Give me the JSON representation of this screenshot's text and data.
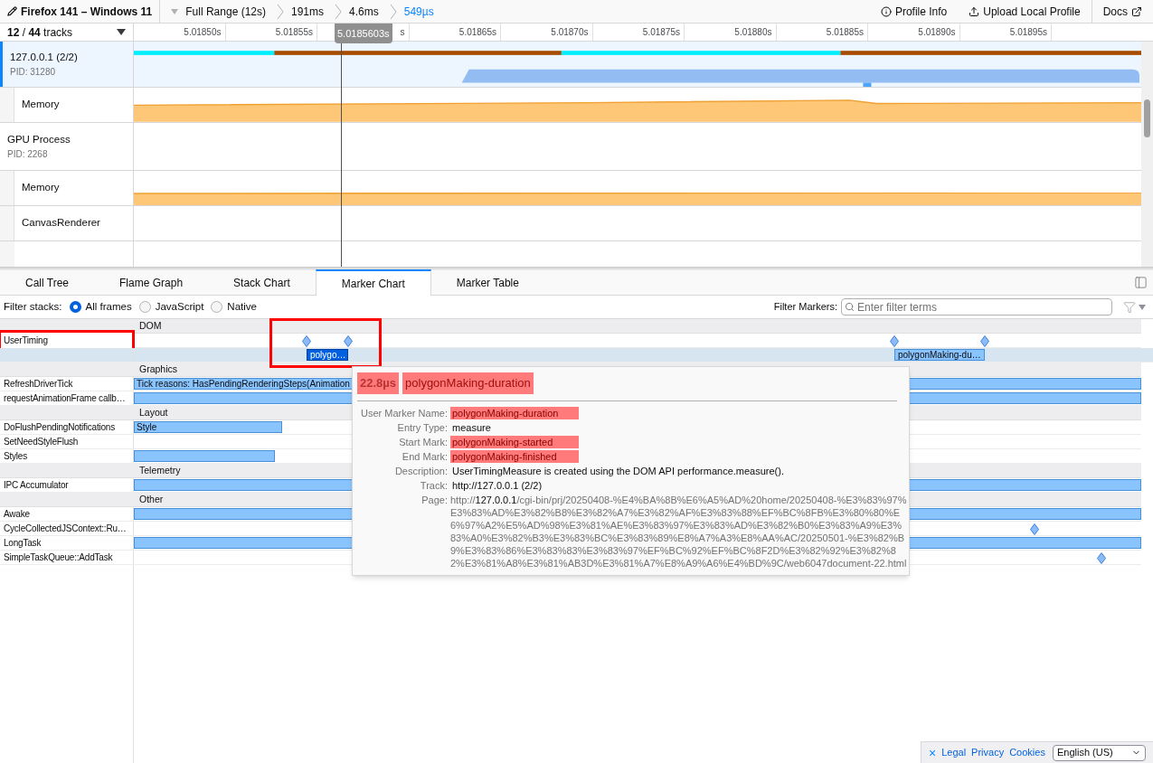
{
  "toolbar": {
    "title": "Firefox 141 – Windows 11",
    "breadcrumbs": [
      {
        "label": "Full Range (12s)",
        "selected": false
      },
      {
        "label": "191ms",
        "selected": false
      },
      {
        "label": "4.6ms",
        "selected": false
      },
      {
        "label": "549µs",
        "selected": true
      }
    ],
    "actions": [
      {
        "kind": "info",
        "label": "Profile Info"
      },
      {
        "kind": "upload",
        "label": "Upload Local Profile"
      },
      {
        "kind": "docs",
        "label": "Docs"
      }
    ]
  },
  "timeline": {
    "track_count": "**12** / **44** tracks",
    "ticks": [
      "5.01850s",
      "5.01855s",
      "s",
      "5.01865s",
      "5.01870s",
      "5.01875s",
      "5.01880s",
      "5.01885s",
      "5.01890s",
      "5.01895s"
    ],
    "hover_time": "5.0185603s",
    "tracks": [
      {
        "kind": "process",
        "name": "127.0.0.1 (2/2)",
        "pid": "PID: 31280",
        "selected": true,
        "children": [
          {
            "kind": "memory",
            "name": "Memory",
            "selected": false
          }
        ]
      },
      {
        "kind": "process",
        "name": "GPU Process",
        "pid": "PID: 2268",
        "selected": false,
        "children": [
          {
            "kind": "memory",
            "name": "Memory",
            "selected": false
          },
          {
            "kind": "canvas",
            "name": "CanvasRenderer",
            "selected": false
          }
        ]
      }
    ]
  },
  "tabs": [
    {
      "label": "Call Tree",
      "selected": false
    },
    {
      "label": "Flame Graph",
      "selected": false
    },
    {
      "label": "Stack Chart",
      "selected": false
    },
    {
      "label": "Marker Chart",
      "selected": true
    },
    {
      "label": "Marker Table",
      "selected": false
    }
  ],
  "filter": {
    "label": "Filter stacks:",
    "options": [
      {
        "label": "All frames",
        "selected": true
      },
      {
        "label": "JavaScript",
        "selected": false
      },
      {
        "label": "Native",
        "selected": false
      }
    ],
    "markers_label": "Filter Markers:",
    "placeholder": "Enter filter terms"
  },
  "marker_rows": [
    {
      "kind": "header",
      "label": "DOM"
    },
    {
      "kind": "row",
      "label": "UserTiming",
      "annotated": true,
      "selected": false
    },
    {
      "kind": "row",
      "selected": true,
      "markers": [
        {
          "label": "polygo…",
          "selected": true,
          "annotated": true
        },
        {
          "label": "polygonMaking-du…",
          "selected": false,
          "annotated": false
        }
      ]
    },
    {
      "kind": "header",
      "label": "Graphics"
    },
    {
      "kind": "row",
      "label": "RefreshDriverTick",
      "annotated": false,
      "selected": false,
      "bar_label": "Tick reasons: HasPendingRenderingSteps(Animation"
    },
    {
      "kind": "row",
      "label": "requestAnimationFrame callb…",
      "annotated": false,
      "selected": false
    },
    {
      "kind": "header",
      "label": "Layout"
    },
    {
      "kind": "row",
      "label": "DoFlushPendingNotifications",
      "annotated": false,
      "selected": false,
      "bar_label": "Style"
    },
    {
      "kind": "row",
      "label": "SetNeedStyleFlush",
      "annotated": false,
      "selected": false
    },
    {
      "kind": "row",
      "label": "Styles",
      "annotated": false,
      "selected": false
    },
    {
      "kind": "header",
      "label": "Telemetry"
    },
    {
      "kind": "row",
      "label": "IPC Accumulator",
      "annotated": false,
      "selected": false
    },
    {
      "kind": "header",
      "label": "Other"
    },
    {
      "kind": "row",
      "label": "Awake",
      "annotated": false,
      "selected": false
    },
    {
      "kind": "row",
      "label": "CycleCollectedJSContext::Ru…",
      "annotated": false,
      "selected": false
    },
    {
      "kind": "row",
      "label": "LongTask",
      "annotated": false,
      "selected": false
    },
    {
      "kind": "row",
      "label": "SimpleTaskQueue::AddTask",
      "annotated": false,
      "selected": false
    }
  ],
  "tooltip": {
    "duration": "22.8µs",
    "title": "polygonMaking-duration",
    "highlighted": true,
    "fields": [
      {
        "label": "User Marker Name:",
        "value": "polygonMaking-duration",
        "highlighted": true
      },
      {
        "label": "Entry Type:",
        "value": "measure",
        "highlighted": false
      },
      {
        "label": "Start Mark:",
        "value": "polygonMaking-started",
        "highlighted": true
      },
      {
        "label": "End Mark:",
        "value": "polygonMaking-finished",
        "highlighted": true
      },
      {
        "label": "Description:",
        "value": "UserTimingMeasure is created using the DOM API performance.measure().",
        "highlighted": false
      },
      {
        "label": "Track:",
        "value": "http://127.0.0.1 (2/2)",
        "highlighted": false
      },
      {
        "label": "Page:",
        "kind": "url",
        "value_parts": [
          "http://",
          "127.0.0.1",
          "/cgi-bin/prj/20250408-%E4%BA%8B%E6%A5%AD%20home/20250408-%E3%83%97%E3%83%AD%E3%82%B8%E3%82%A7%E3%82%AF%E3%83%88%EF%BC%8FB%E3%80%80%E6%97%A2%E5%AD%98%E3%81%AE%E3%83%97%E3%83%AD%E3%82%B0%E3%83%A9%E3%83%A0%E3%82%B3%E3%83%BC%E3%83%89%E8%A7%A3%E8%AA%AC/20250501-%E3%82%B9%E3%83%86%E3%83%83%E3%83%97%EF%BC%92%EF%BC%8F2D%E3%82%92%E3%82%82%E3%81%A8%E3%81%AB3D%E3%81%A7%E8%A9%A6%E4%BD%9C/web6047document-22.html"
        ],
        "highlighted": false
      }
    ]
  },
  "footer": {
    "close": "×",
    "links": [
      "Legal",
      "Privacy",
      "Cookies"
    ],
    "language": "English (US)"
  }
}
